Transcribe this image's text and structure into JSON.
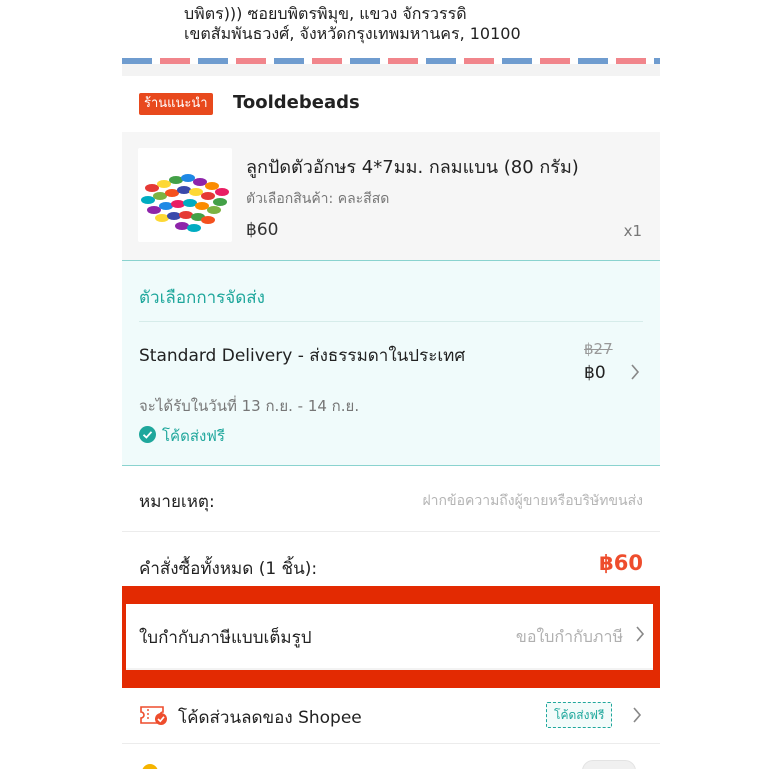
{
  "address": {
    "line1": "บพิตร))) ซอยบพิตรพิมุข, แขวง จักรวรรดิ",
    "line2": "เขตสัมพันธวงศ์, จังหวัดกรุงเทพมหานคร, 10100"
  },
  "shop": {
    "badge": "ร้านแนะนำ",
    "name": "Tooldebeads"
  },
  "product": {
    "name": "ลูกปัดตัวอักษร 4*7มม. กลมแบน (80 กรัม)",
    "variant": "ตัวเลือกสินค้า: คละสีสด",
    "price": "฿60",
    "quantity": "x1"
  },
  "shipping": {
    "title": "ตัวเลือกการจัดส่ง",
    "method": "Standard Delivery - ส่งธรรมดาในประเทศ",
    "original_price": "฿27",
    "price": "฿0",
    "delivery_date": "จะได้รับในวันที่ 13 ก.ย. - 14 ก.ย.",
    "free_shipping": "โค้ดส่งฟรี"
  },
  "note": {
    "label": "หมายเหตุ:",
    "placeholder": "ฝากข้อความถึงผู้ขายหรือบริษัทขนส่ง"
  },
  "order_total": {
    "label": "คำสั่งซื้อทั้งหมด (1 ชิ้น):",
    "value": "฿60"
  },
  "tax_invoice": {
    "label": "ใบกำกับภาษีแบบเต็มรูป",
    "hint": "ขอใบกำกับภาษี"
  },
  "voucher": {
    "label": "โค้ดส่วนลดของ Shopee",
    "tag": "โค้ดส่งฟรี"
  },
  "icons": [
    "check-circle-icon",
    "chevron-right-icon",
    "voucher-ticket-icon",
    "coin-icon"
  ],
  "colors": {
    "accent": "#ee4d2d",
    "highlight": "#e32a02",
    "teal": "#1fa79c"
  }
}
